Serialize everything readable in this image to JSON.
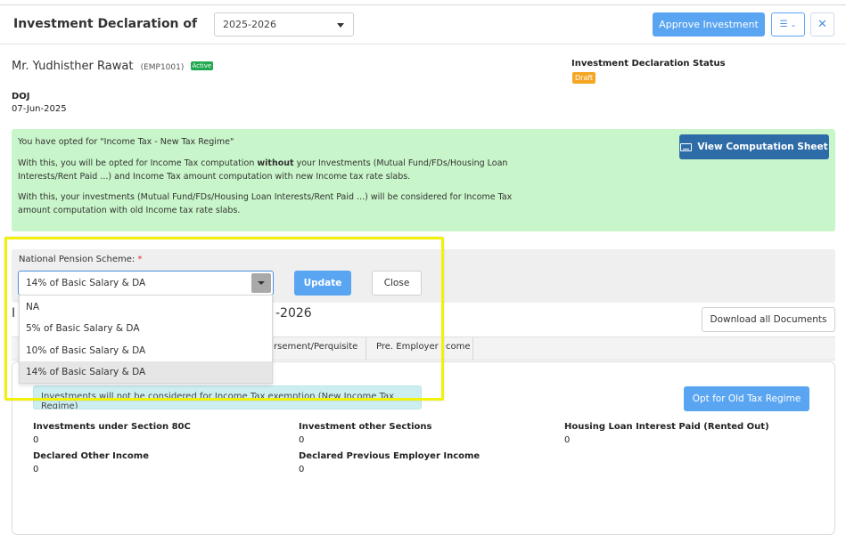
{
  "header": {
    "title": "Investment Declaration of",
    "year_value": "2025-2026",
    "approve_label": "Approve Investment",
    "list_icon": "list-view-icon",
    "close_icon": "close-icon"
  },
  "employee": {
    "name": "Mr. Yudhisther Rawat",
    "code": "(EMP1001)",
    "status_badge": "Active",
    "doj_label": "DOJ",
    "doj_value": "07-Jun-2025"
  },
  "declaration_status": {
    "label": "Investment Declaration Status",
    "badge": "Draft"
  },
  "regime_info": {
    "line1": "You have opted for \"Income Tax - New Tax Regime\"",
    "line2_a": "With this, you will be opted for Income Tax computation ",
    "line2_bold": "without",
    "line2_b": " your Investments (Mutual Fund/FDs/Housing Loan",
    "line2_c": "Interests/Rent Paid ...) and Income Tax amount computation with new Income tax rate slabs.",
    "line3_a": "With this, your investments (Mutual Fund/FDs/Housing Loan Interests/Rent Paid ...) will be considered for Income Tax",
    "line3_b": "amount computation with old Income tax rate slabs.",
    "view_sheet_label": "View Computation Sheet"
  },
  "nps": {
    "label": "National Pension Scheme:",
    "required_mark": "*",
    "selected": "14% of Basic Salary & DA",
    "update_label": "Update",
    "close_label": "Close",
    "options": [
      "NA",
      "5% of Basic Salary & DA",
      "10% of Basic Salary & DA",
      "14% of Basic Salary & DA"
    ]
  },
  "section": {
    "title_prefix": "I",
    "title_suffix": "-2026",
    "download_label": "Download all Documents",
    "tabs": [
      "rsement/Perquisite",
      "Pre. Employer",
      "come"
    ]
  },
  "card": {
    "note": "Investments will not be considered for Income Tax exemption (New Income Tax Regime)",
    "opt_old_label": "Opt for Old Tax Regime",
    "summary": [
      {
        "label": "Investments under Section 80C",
        "value": "0"
      },
      {
        "label": "Investment other Sections",
        "value": "0"
      },
      {
        "label": "Housing Loan Interest Paid (Rented Out)",
        "value": "0"
      },
      {
        "label": "Declared Other Income",
        "value": "0"
      },
      {
        "label": "Declared Previous Employer Income",
        "value": "0"
      }
    ]
  },
  "colors": {
    "primary": "#5aa5f2",
    "dark_button": "#2e6ca8",
    "info_green": "#c8f5c9",
    "active_green": "#1fa84f",
    "draft_orange": "#f5a623",
    "highlight_yellow": "#f1f10a"
  }
}
